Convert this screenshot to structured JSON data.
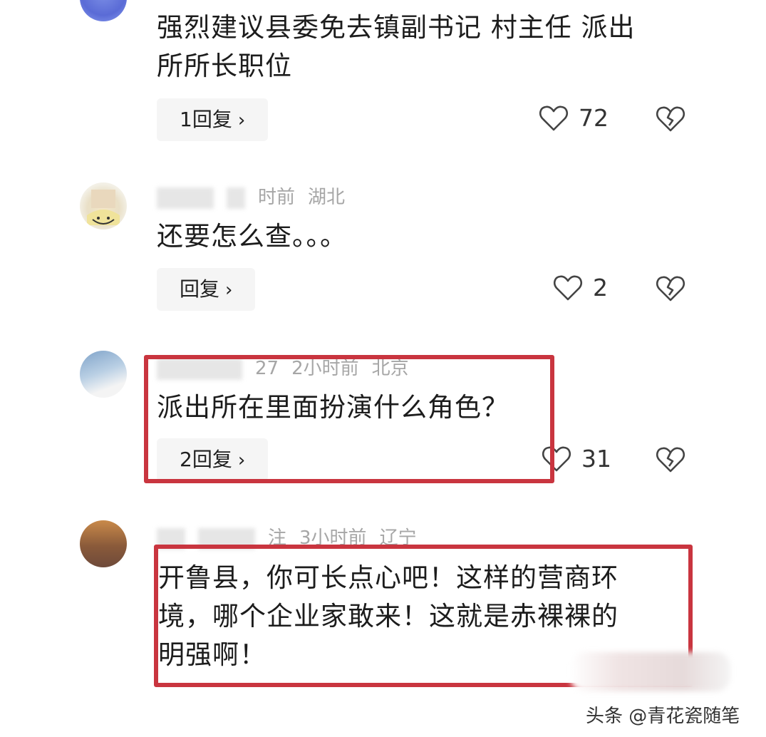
{
  "comments": [
    {
      "text_line1": "强烈建议县委免去镇副书记 村主任 派出",
      "text_line2": "所所长职位",
      "reply_label": "1回复",
      "likes": "72",
      "avatar_icon": "avatar-blue"
    },
    {
      "meta_time": "时前",
      "meta_location": "湖北",
      "text_line1": "还要怎么查。。。",
      "reply_label": "回复",
      "likes": "2",
      "avatar_icon": "avatar-cartoon"
    },
    {
      "meta_partial": "27",
      "meta_time": "2小时前",
      "meta_location": "北京",
      "text_line1": "派出所在里面扮演什么角色？",
      "reply_label": "2回复",
      "likes": "31",
      "avatar_icon": "avatar-blurred"
    },
    {
      "meta_partial": "注",
      "meta_time": "3小时前",
      "meta_location": "辽宁",
      "text_line1": "开鲁县，你可长点心吧！这样的营商环",
      "text_line2": "境，哪个企业家敢来！这就是赤裸裸的",
      "text_line3": "明强啊！",
      "avatar_icon": "avatar-brown"
    }
  ],
  "chevron": "›",
  "watermark": "头条 @青花瓷随笔",
  "colors": {
    "highlight_border": "#c9353f",
    "reply_bg": "#f5f5f5",
    "meta_gray": "#a6a6a6"
  }
}
